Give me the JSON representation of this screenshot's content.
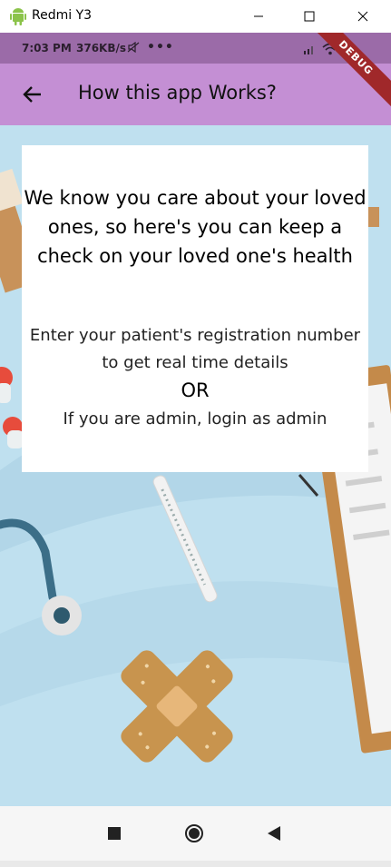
{
  "window": {
    "title": "Redmi Y3"
  },
  "statusbar": {
    "time": "7:03 PM",
    "speed": "376KB/s",
    "dots": "•••"
  },
  "appbar": {
    "title": "How this app Works?"
  },
  "debug": {
    "label": "DEBUG"
  },
  "card": {
    "headline": "We know you care about your loved ones, so here's you can keep a check on your loved one's health",
    "instruction": "Enter your patient's registration number to get real time details",
    "or": "OR",
    "admin": "If you are admin, login as admin"
  },
  "colors": {
    "appbar": "#c48fd4",
    "statusbar": "#9b6ba8",
    "background": "#bfe0ef"
  }
}
